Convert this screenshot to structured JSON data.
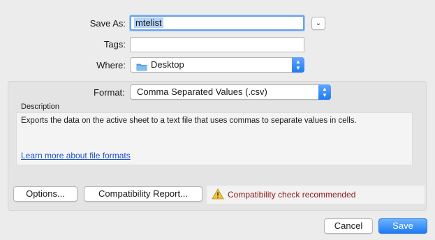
{
  "dialog": {
    "save_as_label": "Save As:",
    "save_as_value": "mtelist",
    "tags_label": "Tags:",
    "tags_value": "",
    "where_label": "Where:",
    "where_value": "Desktop",
    "format_label": "Format:",
    "format_value": "Comma Separated Values (.csv)",
    "description_heading": "Description",
    "description_text": "Exports the data on the active sheet to a text file that uses commas to separate values in cells.",
    "learn_more_link": "Learn more about file formats",
    "options_button": "Options...",
    "compat_report_button": "Compatibility Report...",
    "compat_warning": "Compatibility check recommended",
    "cancel_button": "Cancel",
    "save_button": "Save"
  },
  "icons": {
    "expand": "chevron-down-icon",
    "folder": "folder-icon",
    "stepper": "up-down-stepper-icon",
    "warning": "warning-icon"
  },
  "colors": {
    "accent": "#1e7bf2",
    "warning_text": "#8b1a1a",
    "link": "#1b50c4"
  }
}
